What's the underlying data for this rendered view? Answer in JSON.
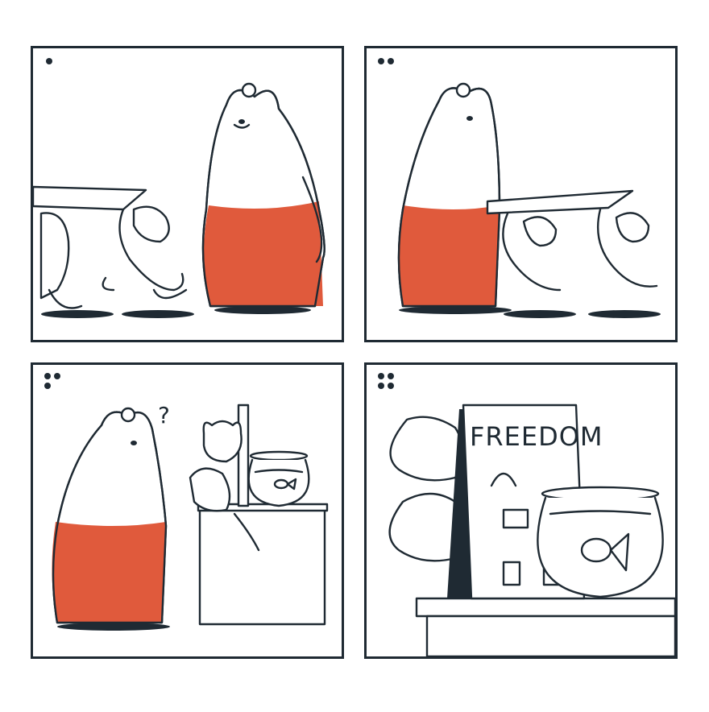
{
  "comic": {
    "panels": [
      {
        "index_dots": 1
      },
      {
        "index_dots": 2
      },
      {
        "index_dots": 3
      },
      {
        "index_dots": 4
      }
    ],
    "question_mark": "?",
    "sign_text": "FREEDOM"
  },
  "colors": {
    "ink": "#1f2a33",
    "bear_pants": "#e05a3c",
    "background": "#ffffff"
  },
  "icons": [
    "panel-number-dots",
    "bear",
    "cat",
    "goldfish",
    "fishbowl",
    "sign-board",
    "question-mark"
  ]
}
